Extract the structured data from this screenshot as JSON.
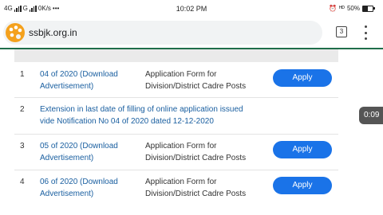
{
  "status_bar": {
    "network_1": "4G",
    "network_2": "G",
    "speed": "0K/s",
    "time": "10:02 PM",
    "right_text": "ᴴᴰ",
    "battery": "50%",
    "battery_level": 0.5
  },
  "browser": {
    "url": "ssbjk.org.in",
    "tab_count": "3"
  },
  "table": {
    "rows": [
      {
        "num": "1",
        "notification_line1": "04 of 2020 (Download",
        "notification_line2": "Advertisement)",
        "desc_line1": "Application Form for",
        "desc_line2": "Division/District Cadre Posts",
        "action": "Apply"
      },
      {
        "num": "2",
        "text_line1": "Extension in last date of filling of online application issued",
        "text_line2": "vide Notification No 04 of 2020 dated 12-12-2020"
      },
      {
        "num": "3",
        "notification_line1": "05 of 2020 (Download",
        "notification_line2": "Advertisement)",
        "desc_line1": "Application Form for",
        "desc_line2": "Division/District Cadre Posts",
        "action": "Apply"
      },
      {
        "num": "4",
        "notification_line1": "06 of 2020 (Download",
        "notification_line2": "Advertisement)",
        "desc_line1": "Application Form for",
        "desc_line2": "Division/District Cadre Posts",
        "action": "Apply"
      }
    ]
  },
  "video_overlay": {
    "timer": "0:09"
  },
  "colors": {
    "accent": "#1a73e8",
    "link": "#1a5fa0",
    "header_rule": "#1f6e4a",
    "site_icon": "#f4a11d"
  },
  "icons": [
    "signal-icon",
    "palette-icon",
    "tab-switcher-icon",
    "more-vert-icon",
    "battery-icon"
  ]
}
